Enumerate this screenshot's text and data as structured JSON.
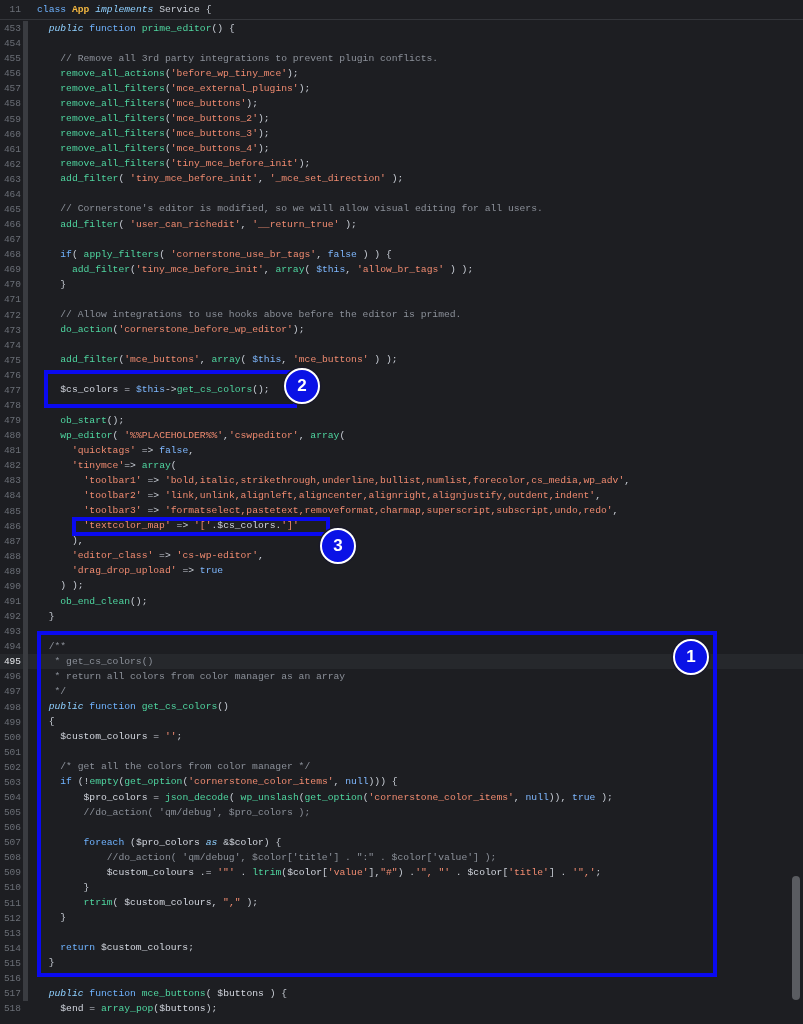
{
  "sticky_line": {
    "number": "11",
    "code": "class App implements Service {"
  },
  "lines": [
    {
      "number": "453",
      "code": "  public function prime_editor() {",
      "current": false
    },
    {
      "number": "454",
      "current": false
    },
    {
      "number": "455",
      "code": "    // Remove all 3rd party integrations to prevent plugin conflicts.",
      "current": false
    },
    {
      "number": "456",
      "code": "    remove_all_actions('before_wp_tiny_mce');",
      "current": false
    },
    {
      "number": "457",
      "code": "    remove_all_filters('mce_external_plugins');",
      "current": false
    },
    {
      "number": "458",
      "code": "    remove_all_filters('mce_buttons');",
      "current": false
    },
    {
      "number": "459",
      "code": "    remove_all_filters('mce_buttons_2');",
      "current": false
    },
    {
      "number": "460",
      "code": "    remove_all_filters('mce_buttons_3');",
      "current": false
    },
    {
      "number": "461",
      "code": "    remove_all_filters('mce_buttons_4');",
      "current": false
    },
    {
      "number": "462",
      "code": "    remove_all_filters('tiny_mce_before_init');",
      "current": false
    },
    {
      "number": "463",
      "code": "    add_filter( 'tiny_mce_before_init', '_mce_set_direction' );",
      "current": false
    },
    {
      "number": "464",
      "current": false
    },
    {
      "number": "465",
      "code": "    // Cornerstone's editor is modified, so we will allow visual editing for all users.",
      "current": false
    },
    {
      "number": "466",
      "code": "    add_filter( 'user_can_richedit', '__return_true' );",
      "current": false
    },
    {
      "number": "467",
      "current": false
    },
    {
      "number": "468",
      "code": "    if( apply_filters( 'cornerstone_use_br_tags', false ) ) {",
      "current": false
    },
    {
      "number": "469",
      "code": "      add_filter('tiny_mce_before_init', array( $this, 'allow_br_tags' ) );",
      "current": false
    },
    {
      "number": "470",
      "code": "    }",
      "current": false
    },
    {
      "number": "471",
      "current": false
    },
    {
      "number": "472",
      "code": "    // Allow integrations to use hooks above before the editor is primed.",
      "current": false
    },
    {
      "number": "473",
      "code": "    do_action('cornerstone_before_wp_editor');",
      "current": false
    },
    {
      "number": "474",
      "current": false
    },
    {
      "number": "475",
      "code": "    add_filter('mce_buttons', array( $this, 'mce_buttons' ) );",
      "current": false
    },
    {
      "number": "476",
      "current": false
    },
    {
      "number": "477",
      "code": "    $cs_colors = $this->get_cs_colors();",
      "current": false
    },
    {
      "number": "478",
      "current": false
    },
    {
      "number": "479",
      "code": "    ob_start();",
      "current": false
    },
    {
      "number": "480",
      "code": "    wp_editor( '%%PLACEHOLDER%%','cswpeditor', array(",
      "current": false
    },
    {
      "number": "481",
      "code": "      'quicktags' => false,",
      "current": false
    },
    {
      "number": "482",
      "code": "      'tinymce'=> array(",
      "current": false
    },
    {
      "number": "483",
      "code": "        'toolbar1' => 'bold,italic,strikethrough,underline,bullist,numlist,forecolor,cs_media,wp_adv',",
      "current": false
    },
    {
      "number": "484",
      "code": "        'toolbar2' => 'link,unlink,alignleft,aligncenter,alignright,alignjustify,outdent,indent',",
      "current": false
    },
    {
      "number": "485",
      "code": "        'toolbar3' => 'formatselect,pastetext,removeformat,charmap,superscript,subscript,undo,redo',",
      "current": false
    },
    {
      "number": "486",
      "code": "        'textcolor_map' => '['.$cs_colors.']'",
      "current": false
    },
    {
      "number": "487",
      "code": "      ),",
      "current": false
    },
    {
      "number": "488",
      "code": "      'editor_class' => 'cs-wp-editor',",
      "current": false
    },
    {
      "number": "489",
      "code": "      'drag_drop_upload' => true",
      "current": false
    },
    {
      "number": "490",
      "code": "    ) );",
      "current": false
    },
    {
      "number": "491",
      "code": "    ob_end_clean();",
      "current": false
    },
    {
      "number": "492",
      "code": "  }",
      "current": false
    },
    {
      "number": "493",
      "current": false
    },
    {
      "number": "494",
      "code": "  /**",
      "current": false
    },
    {
      "number": "495",
      "code": "   * get_cs_colors()",
      "current": true
    },
    {
      "number": "496",
      "code": "   * return all colors from color manager as an array",
      "current": false
    },
    {
      "number": "497",
      "code": "   */",
      "current": false
    },
    {
      "number": "498",
      "code": "  public function get_cs_colors()",
      "current": false
    },
    {
      "number": "499",
      "code": "  {",
      "current": false
    },
    {
      "number": "500",
      "code": "    $custom_colours = '';",
      "current": false
    },
    {
      "number": "501",
      "current": false
    },
    {
      "number": "502",
      "code": "    /* get all the colors from color manager */",
      "current": false
    },
    {
      "number": "503",
      "code": "    if (!empty(get_option('cornerstone_color_items', null))) {",
      "current": false
    },
    {
      "number": "504",
      "code": "        $pro_colors = json_decode( wp_unslash(get_option('cornerstone_color_items', null)), true );",
      "current": false
    },
    {
      "number": "505",
      "code": "        //do_action( 'qm/debug', $pro_colors );",
      "current": false
    },
    {
      "number": "506",
      "current": false
    },
    {
      "number": "507",
      "code": "        foreach ($pro_colors as &$color) {",
      "current": false
    },
    {
      "number": "508",
      "code": "            //do_action( 'qm/debug', $color['title'] . \":\" . $color['value'] );",
      "current": false
    },
    {
      "number": "509",
      "code": "            $custom_colours .= '\"' . ltrim($color['value'],\"#\") .'\", \"' . $color['title'] . '\",';",
      "current": false
    },
    {
      "number": "510",
      "code": "        }",
      "current": false
    },
    {
      "number": "511",
      "code": "        rtrim( $custom_colours, \",\" );",
      "current": false
    },
    {
      "number": "512",
      "code": "    }",
      "current": false
    },
    {
      "number": "513",
      "current": false
    },
    {
      "number": "514",
      "code": "    return $custom_colours;",
      "current": false
    },
    {
      "number": "515",
      "code": "  }",
      "current": false
    },
    {
      "number": "516",
      "current": false
    },
    {
      "number": "517",
      "code": "  public function mce_buttons( $buttons ) {",
      "current": false
    },
    {
      "number": "518",
      "code": "    $end = array_pop($buttons);",
      "current": false
    }
  ],
  "annotations": [
    {
      "label": "1"
    },
    {
      "label": "2"
    },
    {
      "label": "3"
    }
  ]
}
